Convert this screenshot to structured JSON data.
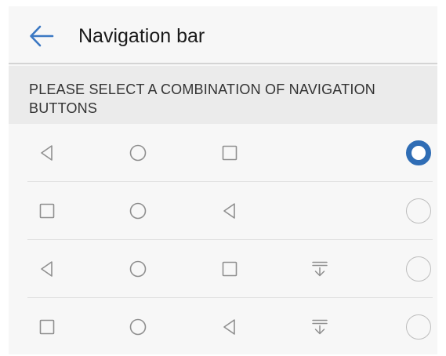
{
  "header": {
    "title": "Navigation bar",
    "back_icon": "arrow-left-icon",
    "accent_color": "#3b78c3"
  },
  "section": {
    "label": "PLEASE SELECT A COMBINATION OF NAVIGATION BUTTONS"
  },
  "options": [
    {
      "buttons": [
        "back-icon",
        "home-icon",
        "recents-icon"
      ],
      "selected": true
    },
    {
      "buttons": [
        "recents-icon",
        "home-icon",
        "back-icon"
      ],
      "selected": false
    },
    {
      "buttons": [
        "back-icon",
        "home-icon",
        "recents-icon",
        "notification-pulldown-icon"
      ],
      "selected": false
    },
    {
      "buttons": [
        "recents-icon",
        "home-icon",
        "back-icon",
        "notification-pulldown-icon"
      ],
      "selected": false
    }
  ],
  "colors": {
    "radio_selected": "#2f6db5",
    "radio_unselected": "#bdbdbd",
    "nav_icon": "#8f8f8f"
  }
}
